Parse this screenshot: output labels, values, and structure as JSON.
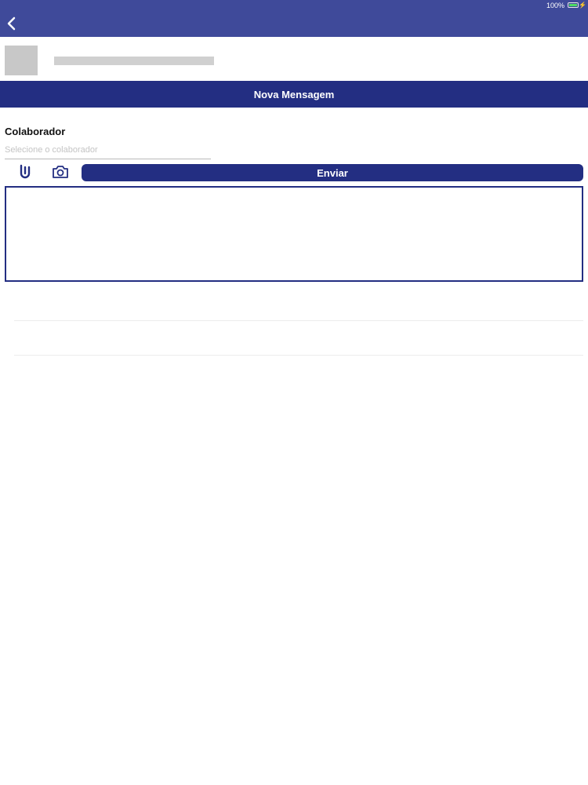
{
  "status_bar": {
    "battery_percent": "100%"
  },
  "header": {
    "title": "Nova Mensagem"
  },
  "form": {
    "colaborador_label": "Colaborador",
    "colaborador_placeholder": "Selecione o colaborador",
    "send_label": "Enviar",
    "message_value": ""
  },
  "icons": {
    "back": "chevron-left-icon",
    "attach": "paperclip-icon",
    "camera": "camera-icon"
  },
  "colors": {
    "header_bar": "#3f4a9a",
    "primary": "#232e82"
  }
}
